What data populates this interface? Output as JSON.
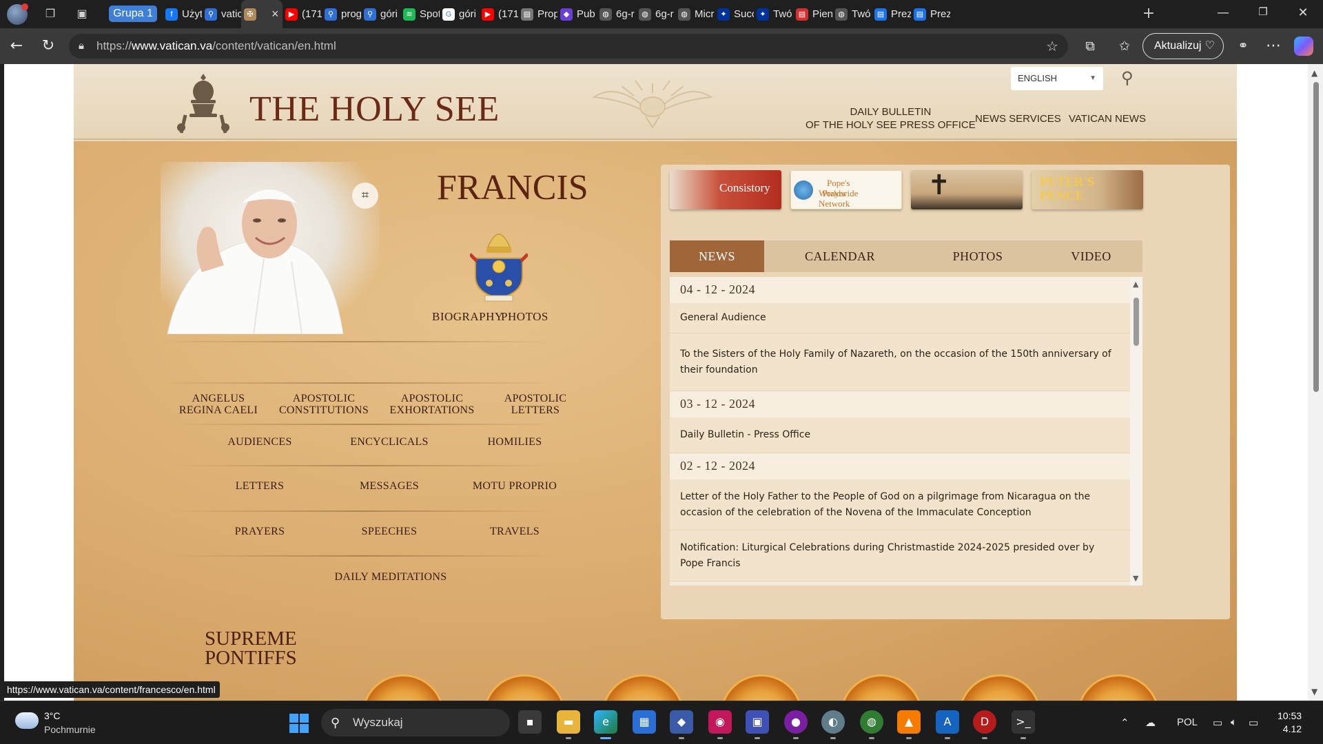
{
  "browser": {
    "group_label": "Grupa 1",
    "tabs": [
      {
        "title": "Użyt",
        "icon": "facebook-icon",
        "color": "#1877f2"
      },
      {
        "title": "vatic",
        "icon": "search-icon",
        "color": "#2f6fd6"
      },
      {
        "title": "",
        "icon": "vatican-icon",
        "color": "#b08a5a",
        "active": true
      },
      {
        "title": "(171",
        "icon": "youtube-icon",
        "color": "#ff0000"
      },
      {
        "title": "prog",
        "icon": "search-icon",
        "color": "#2f6fd6"
      },
      {
        "title": "góri",
        "icon": "search-icon",
        "color": "#2f6fd6"
      },
      {
        "title": "Spot",
        "icon": "spotify-icon",
        "color": "#1db954"
      },
      {
        "title": "góri",
        "icon": "google-icon",
        "color": "#ffffff"
      },
      {
        "title": "(171",
        "icon": "youtube-icon",
        "color": "#ff0000"
      },
      {
        "title": "Prop",
        "icon": "page-icon",
        "color": "#777777"
      },
      {
        "title": "Pub",
        "icon": "app-icon",
        "color": "#6a3fd6"
      },
      {
        "title": "6g-r",
        "icon": "globe-icon",
        "color": "#555555"
      },
      {
        "title": "6g-r",
        "icon": "globe-icon",
        "color": "#555555"
      },
      {
        "title": "Micr",
        "icon": "globe-icon",
        "color": "#555555"
      },
      {
        "title": "Succ",
        "icon": "eu-icon",
        "color": "#003399"
      },
      {
        "title": "Twó",
        "icon": "eu-icon",
        "color": "#003399"
      },
      {
        "title": "Pien",
        "icon": "pdf-icon",
        "color": "#d32f2f"
      },
      {
        "title": "Twó",
        "icon": "globe-icon",
        "color": "#555555"
      },
      {
        "title": "Prez",
        "icon": "doc-icon",
        "color": "#1a73e8"
      },
      {
        "title": "Prez",
        "icon": "doc-icon",
        "color": "#1a73e8"
      }
    ],
    "url_prefix": "https://",
    "url_host": "www.vatican.va",
    "url_path": "/content/vatican/en.html",
    "update_label": "Aktualizuj",
    "status_url": "https://www.vatican.va/content/francesco/en.html"
  },
  "site": {
    "title": "THE HOLY SEE",
    "language": "ENGLISH",
    "nav": {
      "bulletin_line1": "DAILY BULLETIN",
      "bulletin_line2": "OF THE HOLY SEE PRESS OFFICE",
      "news_services": "NEWS SERVICES",
      "vatican_news": "VATICAN NEWS"
    },
    "pope": {
      "name": "FRANCIS",
      "biography": "BIOGRAPHY",
      "photos": "PHOTOS"
    },
    "categories": {
      "angelus_1": "ANGELUS",
      "angelus_2": "REGINA CAELI",
      "apconst_1": "APOSTOLIC",
      "apconst_2": "CONSTITUTIONS",
      "apexh_1": "APOSTOLIC",
      "apexh_2": "EXHORTATIONS",
      "aplet_1": "APOSTOLIC",
      "aplet_2": "LETTERS",
      "audiences": "AUDIENCES",
      "encyclicals": "ENCYCLICALS",
      "homilies": "HOMILIES",
      "letters": "LETTERS",
      "messages": "MESSAGES",
      "motu_proprio": "MOTU PROPRIO",
      "prayers": "PRAYERS",
      "speeches": "SPEECHES",
      "travels": "TRAVELS",
      "daily_meditations": "DAILY MEDITATIONS"
    },
    "banners": {
      "consistory": "Consistory",
      "prayer_net_1": "Pope's Worldwide",
      "prayer_net_2": "Prayer Network",
      "peters_pence_1": "PETER'S",
      "peters_pence_2": "PENCE"
    },
    "panel_tabs": {
      "news": "NEWS",
      "calendar": "CALENDAR",
      "photos": "PHOTOS",
      "video": "VIDEO"
    },
    "news": {
      "date1": "04 - 12 - 2024",
      "item1": "General Audience",
      "item2": "To the Sisters of the Holy Family of Nazareth, on the occasion of the 150th anniversary of their foundation",
      "date2": "03 - 12 - 2024",
      "item3": "Daily Bulletin - Press Office",
      "date3": "02 - 12 - 2024",
      "item4": "Letter of the Holy Father to the People of God on a pilgrimage from Nicaragua on the occasion of the celebration of the Novena of the Immaculate Conception",
      "item5": "Notification: Liturgical Celebrations during Christmastide 2024-2025 presided over by Pope Francis"
    },
    "supreme_1": "SUPREME",
    "supreme_2": "PONTIFFS"
  },
  "taskbar": {
    "temperature": "3°C",
    "weather": "Pochmurnie",
    "search_placeholder": "Wyszukaj",
    "language": "POL",
    "time": "10:53",
    "date": "4.12"
  }
}
